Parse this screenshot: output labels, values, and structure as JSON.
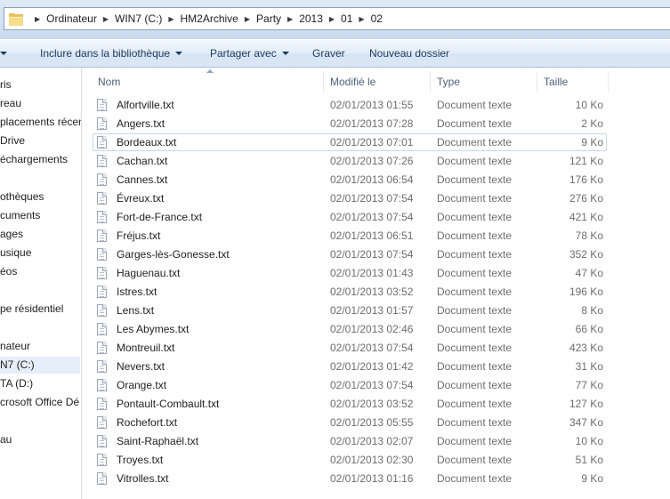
{
  "address_bar": {
    "breadcrumbs": [
      "Ordinateur",
      "WIN7 (C:)",
      "HM2Archive",
      "Party",
      "2013",
      "01",
      "02"
    ]
  },
  "toolbar": {
    "organize_fragment": "",
    "include_library_label": "Inclure dans la bibliothèque",
    "share_with_label": "Partager avec",
    "burn_label": "Graver",
    "new_folder_label": "Nouveau dossier"
  },
  "nav_pane": {
    "items": [
      "ris",
      "reau",
      "placements récen",
      "Drive",
      "échargements",
      "othèques",
      "cuments",
      "ages",
      "usique",
      "éos",
      "pe résidentiel",
      "nateur",
      "N7 (C:)",
      "TA (D:)",
      "crosoft Office Dé",
      "au"
    ],
    "selected_index": 12
  },
  "file_list": {
    "columns": {
      "name": "Nom",
      "modified": "Modifié le",
      "type": "Type",
      "size": "Taille"
    },
    "focused_index": 2,
    "rows": [
      {
        "name": "Alfortville.txt",
        "modified": "02/01/2013 01:55",
        "type": "Document texte",
        "size": "10 Ko"
      },
      {
        "name": "Angers.txt",
        "modified": "02/01/2013 07:28",
        "type": "Document texte",
        "size": "2 Ko"
      },
      {
        "name": "Bordeaux.txt",
        "modified": "02/01/2013 07:01",
        "type": "Document texte",
        "size": "9 Ko"
      },
      {
        "name": "Cachan.txt",
        "modified": "02/01/2013 07:26",
        "type": "Document texte",
        "size": "121 Ko"
      },
      {
        "name": "Cannes.txt",
        "modified": "02/01/2013 06:54",
        "type": "Document texte",
        "size": "176 Ko"
      },
      {
        "name": "Évreux.txt",
        "modified": "02/01/2013 07:54",
        "type": "Document texte",
        "size": "276 Ko"
      },
      {
        "name": "Fort-de-France.txt",
        "modified": "02/01/2013 07:54",
        "type": "Document texte",
        "size": "421 Ko"
      },
      {
        "name": "Fréjus.txt",
        "modified": "02/01/2013 06:51",
        "type": "Document texte",
        "size": "78 Ko"
      },
      {
        "name": "Garges-lès-Gonesse.txt",
        "modified": "02/01/2013 07:54",
        "type": "Document texte",
        "size": "352 Ko"
      },
      {
        "name": "Haguenau.txt",
        "modified": "02/01/2013 01:43",
        "type": "Document texte",
        "size": "47 Ko"
      },
      {
        "name": "Istres.txt",
        "modified": "02/01/2013 03:52",
        "type": "Document texte",
        "size": "196 Ko"
      },
      {
        "name": "Lens.txt",
        "modified": "02/01/2013 01:57",
        "type": "Document texte",
        "size": "8 Ko"
      },
      {
        "name": "Les Abymes.txt",
        "modified": "02/01/2013 02:46",
        "type": "Document texte",
        "size": "66 Ko"
      },
      {
        "name": "Montreuil.txt",
        "modified": "02/01/2013 07:54",
        "type": "Document texte",
        "size": "423 Ko"
      },
      {
        "name": "Nevers.txt",
        "modified": "02/01/2013 01:42",
        "type": "Document texte",
        "size": "31 Ko"
      },
      {
        "name": "Orange.txt",
        "modified": "02/01/2013 07:54",
        "type": "Document texte",
        "size": "77 Ko"
      },
      {
        "name": "Pontault-Combault.txt",
        "modified": "02/01/2013 03:52",
        "type": "Document texte",
        "size": "127 Ko"
      },
      {
        "name": "Rochefort.txt",
        "modified": "02/01/2013 05:55",
        "type": "Document texte",
        "size": "347 Ko"
      },
      {
        "name": "Saint-Raphaël.txt",
        "modified": "02/01/2013 02:07",
        "type": "Document texte",
        "size": "10 Ko"
      },
      {
        "name": "Troyes.txt",
        "modified": "02/01/2013 02:30",
        "type": "Document texte",
        "size": "51 Ko"
      },
      {
        "name": "Vitrolles.txt",
        "modified": "02/01/2013 01:16",
        "type": "Document texte",
        "size": "9 Ko"
      }
    ]
  }
}
